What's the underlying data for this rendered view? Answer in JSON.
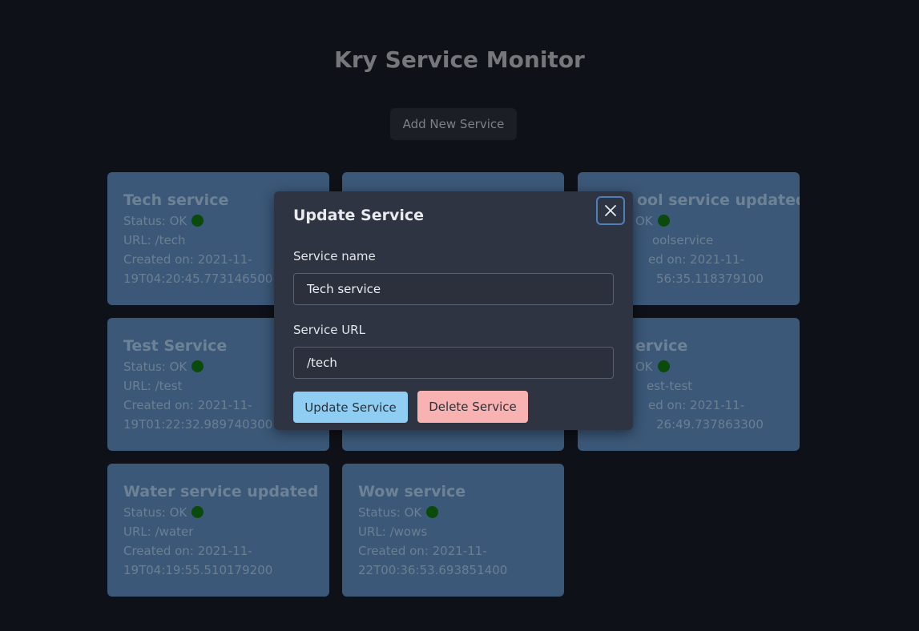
{
  "app": {
    "title": "Kry Service Monitor",
    "add_button_label": "Add New Service"
  },
  "services": [
    {
      "name": "Tech service",
      "status": "Status: OK",
      "url": "URL: /tech",
      "created_line1": "Created on: 2021-11-",
      "created_line2": "19T04:20:45.773146500"
    },
    {
      "name": "",
      "status": "",
      "url": "",
      "created_line1": "",
      "created_line2": ""
    },
    {
      "name": "ool service updated",
      "status": "OK",
      "url": "oolservice",
      "created_line1": "ed on: 2021-11-",
      "created_line2": "56:35.118379100"
    },
    {
      "name": "Test Service",
      "status": "Status: OK",
      "url": "URL: /test",
      "created_line1": "Created on: 2021-11-",
      "created_line2": "19T01:22:32.989740300"
    },
    {
      "name": "",
      "status": "",
      "url": "",
      "created_line1": "",
      "created_line2": ""
    },
    {
      "name": "ervice",
      "status": "OK",
      "url": "est-test",
      "created_line1": "ed on: 2021-11-",
      "created_line2": "26:49.737863300"
    },
    {
      "name": "Water service updated",
      "status": "Status: OK",
      "url": "URL: /water",
      "created_line1": "Created on: 2021-11-",
      "created_line2": "19T04:19:55.510179200"
    },
    {
      "name": "Wow service",
      "status": "Status: OK",
      "url": "URL: /wows",
      "created_line1": "Created on: 2021-11-",
      "created_line2": "22T00:36:53.693851400"
    }
  ],
  "modal": {
    "title": "Update Service",
    "name_label": "Service name",
    "name_value": "Tech service",
    "url_label": "Service URL",
    "url_value": "/tech",
    "update_label": "Update Service",
    "delete_label": "Delete Service",
    "close_icon": "close-icon"
  },
  "colors": {
    "background": "#0e1117",
    "card": "#3b5878",
    "status_ok": "#0a4a0a",
    "modal": "#2e3442",
    "update_button": "#8fcdf2",
    "delete_button": "#f9b2b2",
    "focus_ring": "#4d7fba"
  }
}
